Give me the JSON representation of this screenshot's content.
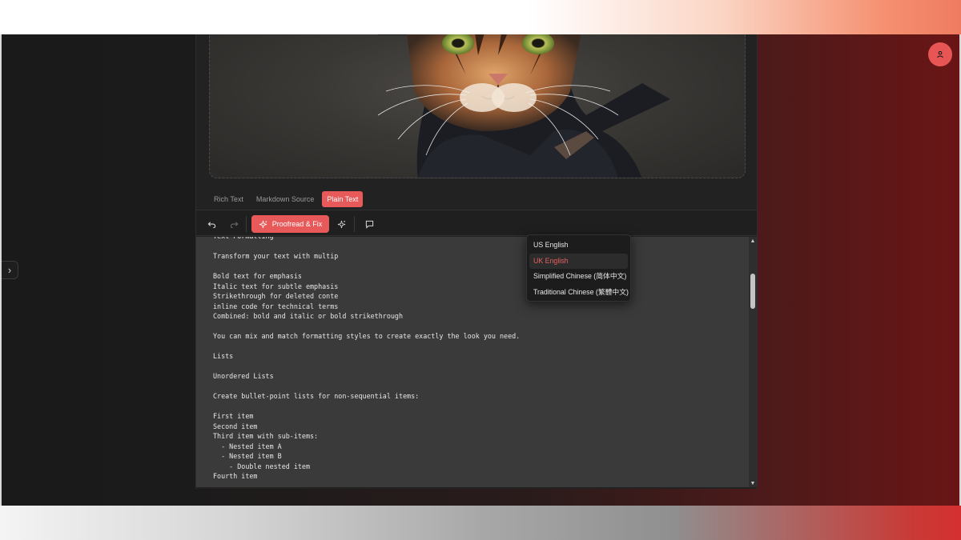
{
  "tabs": [
    {
      "label": "Rich Text",
      "active": false
    },
    {
      "label": "Markdown Source",
      "active": false
    },
    {
      "label": "Plain Text",
      "active": true
    }
  ],
  "toolbar": {
    "proofread_label": "Proofread & Fix",
    "icons": [
      "undo-icon",
      "redo-icon",
      "sparkle-icon",
      "magic-wand-icon",
      "comment-icon"
    ]
  },
  "language_menu": {
    "items": [
      {
        "label": "US English",
        "selected": false
      },
      {
        "label": "UK English",
        "selected": true
      },
      {
        "label": "Simplified Chinese (简体中文)",
        "selected": false
      },
      {
        "label": "Traditional Chinese (繁體中文)",
        "selected": false
      }
    ]
  },
  "editor": {
    "lines": [
      "Text Formatting",
      "",
      "Transform your text with multip",
      "",
      "Bold text for emphasis",
      "Italic text for subtle emphasis",
      "Strikethrough for deleted conte",
      "inline code for technical terms",
      "Combined: bold and italic or bold strikethrough",
      "",
      "You can mix and match formatting styles to create exactly the look you need.",
      "",
      "Lists",
      "",
      "Unordered Lists",
      "",
      "Create bullet-point lists for non-sequential items:",
      "",
      "First item",
      "Second item",
      "Third item with sub-items:",
      "  - Nested item A",
      "  - Nested item B",
      "    - Double nested item",
      "Fourth item"
    ]
  },
  "colors": {
    "accent": "#e85a5a",
    "selected_text": "#e86060",
    "editor_bg": "#3a3a3a"
  }
}
